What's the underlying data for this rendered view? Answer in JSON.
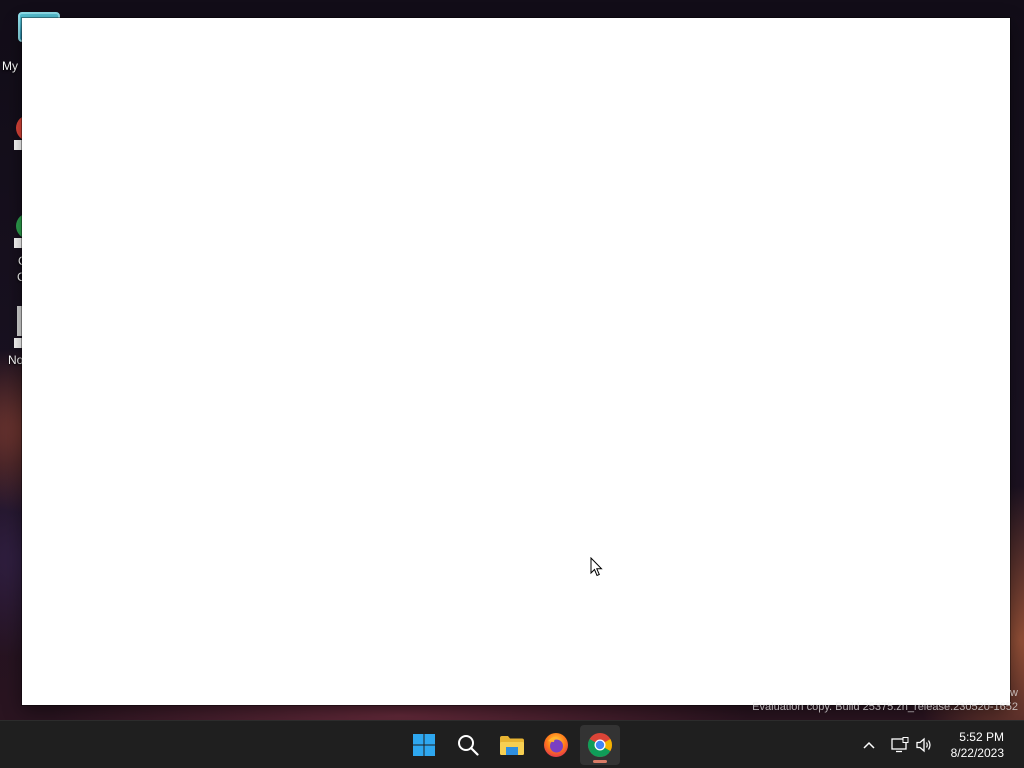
{
  "desktop": {
    "icons": [
      {
        "label": "My",
        "icon": "this-pc-icon"
      },
      {
        "label": "",
        "icon": "app-shortcut-icon"
      },
      {
        "label": "C",
        "icon": "chrome-shortcut-icon",
        "label2": "C"
      },
      {
        "label": "No",
        "icon": "notepad-shortcut-icon"
      }
    ]
  },
  "window": {
    "content": ""
  },
  "watermark": {
    "line1": "w",
    "line2": "Evaluation copy. Build 25375.zn_release.230520-1652"
  },
  "taskbar": {
    "apps": [
      {
        "name": "Start",
        "icon": "windows-start-icon"
      },
      {
        "name": "Search",
        "icon": "search-icon"
      },
      {
        "name": "File Explorer",
        "icon": "folder-icon"
      },
      {
        "name": "Firefox",
        "icon": "firefox-icon"
      },
      {
        "name": "Google Chrome",
        "icon": "chrome-icon",
        "active": true
      }
    ],
    "tray": {
      "chevron": "chevron-up-icon",
      "network": "network-icon",
      "volume": "volume-icon"
    },
    "clock": {
      "time": "5:52 PM",
      "date": "8/22/2023"
    }
  },
  "colors": {
    "taskbar": "#1f1f1f",
    "window": "#ffffff",
    "accent_indicator": "#d97b66"
  }
}
